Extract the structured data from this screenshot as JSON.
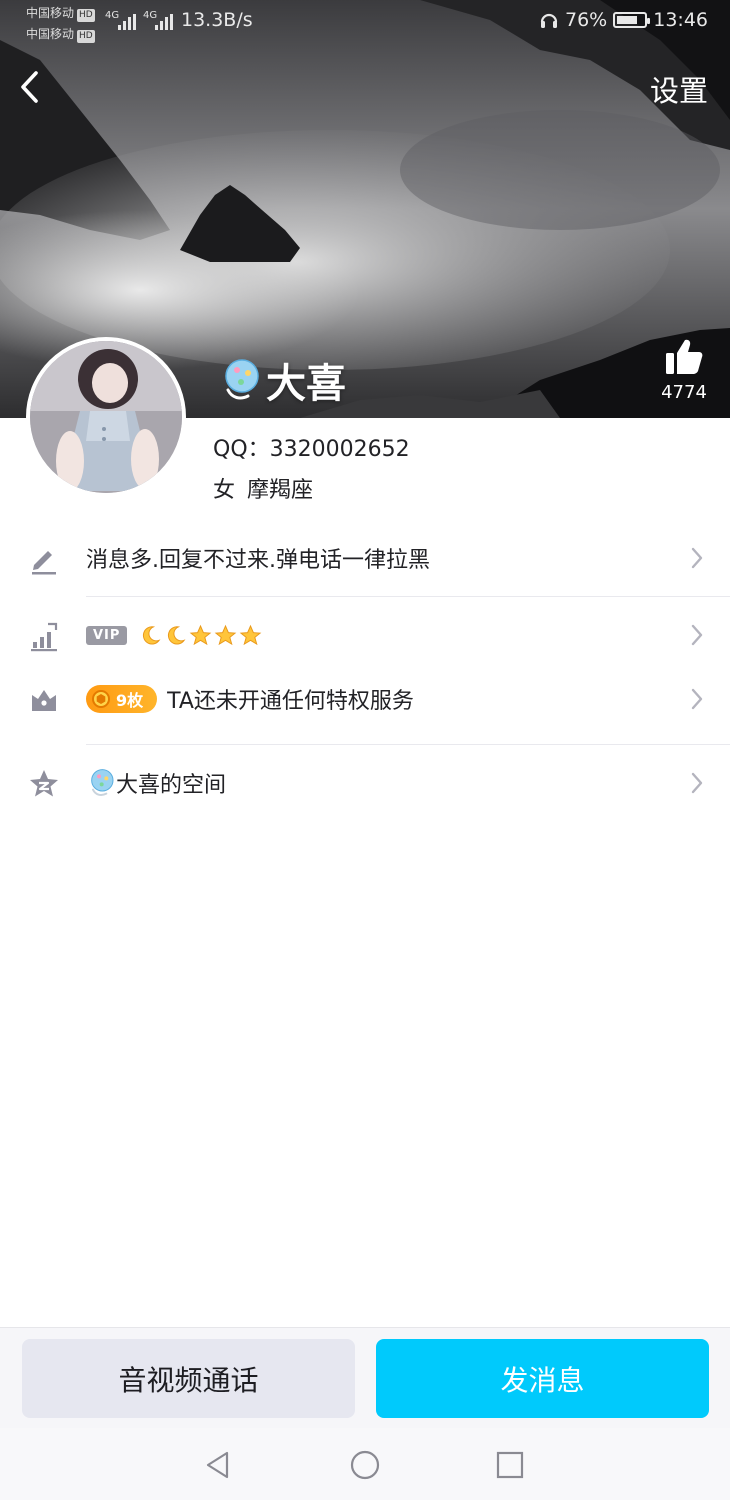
{
  "status_bar": {
    "carrier_1": "中国移动",
    "carrier_2": "中国移动",
    "hd_badge": "HD",
    "network": "4G",
    "net_speed": "13.3B/s",
    "battery": "76%",
    "battery_level": 0.76,
    "time": "13:46"
  },
  "nav": {
    "back_icon": "chevron-left-icon",
    "settings_label": "设置"
  },
  "profile": {
    "name": "大喜",
    "name_icon": "balloon-icon",
    "likes": "4774",
    "qq_label": "QQ：",
    "qq_number": "3320002652",
    "gender": "女",
    "zodiac": "摩羯座"
  },
  "rows": {
    "signature": {
      "icon": "pencil-icon",
      "text": "消息多.回复不过来.弹电话一律拉黑"
    },
    "level": {
      "icon": "bar-chart-icon",
      "vip_tag": "VIP",
      "moons": 2,
      "stars": 3
    },
    "privilege": {
      "icon": "crown-icon",
      "coin_label": "9枚",
      "text": "TA还未开通任何特权服务"
    },
    "space": {
      "icon": "star-icon",
      "text": "大喜的空间"
    }
  },
  "bottom": {
    "call_label": "音视频通话",
    "message_label": "发消息"
  },
  "colors": {
    "accent": "#00cafc",
    "secondary_button": "#e6e7f0",
    "coin_orange": "#ffa41c",
    "icon_gray": "#8e8e9c"
  }
}
